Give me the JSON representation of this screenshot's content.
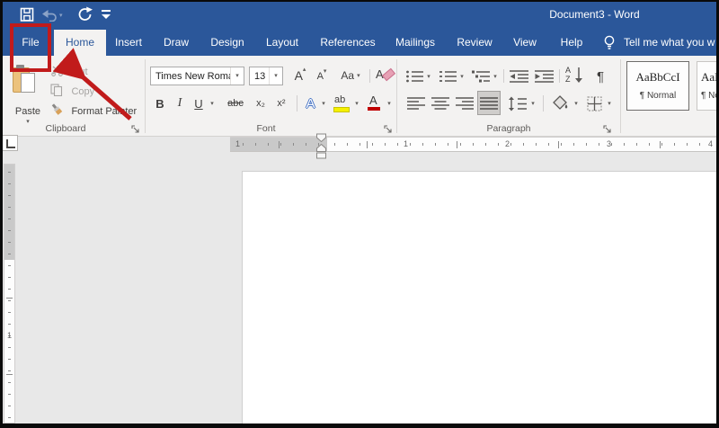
{
  "icons": {
    "caret": "▾",
    "caret_up": "▴"
  },
  "titlebar": {
    "title": "Document3 - Word"
  },
  "tabs": {
    "file": "File",
    "home": "Home",
    "insert": "Insert",
    "draw": "Draw",
    "design": "Design",
    "layout": "Layout",
    "references": "References",
    "mailings": "Mailings",
    "review": "Review",
    "view": "View",
    "help": "Help",
    "tell_me": "Tell me what you w"
  },
  "clipboard": {
    "label": "Clipboard",
    "paste": "Paste",
    "cut": "Cut",
    "copy": "Copy",
    "format_painter": "Format Painter"
  },
  "font": {
    "label": "Font",
    "name": "Times New Roma",
    "size": "13",
    "grow": "A",
    "shrink": "A",
    "change_case": "Aa",
    "clear": "A",
    "bold": "B",
    "italic": "I",
    "underline": "U",
    "strikethrough": "abc",
    "subscript": "x₂",
    "superscript": "x²",
    "effects": "A",
    "highlight": "ab",
    "color": "A"
  },
  "paragraph": {
    "label": "Paragraph",
    "sort_a": "A",
    "sort_z": "Z",
    "pilcrow": "¶"
  },
  "styles": {
    "normal_sample": "AaBbCcI",
    "normal_name": "¶ Normal",
    "nospacing_sample": "AaB",
    "nospacing_name": "¶ No"
  },
  "ruler": {
    "margin": "1",
    "n1": "1",
    "n2": "2",
    "n3": "3",
    "n4": "4",
    "v1": "1"
  },
  "colors": {
    "titlebar_blue": "#2B579A",
    "ribbon_gray": "#F3F2F1",
    "annotation_red": "#C11B1B",
    "highlight_yellow": "#F5F000",
    "font_color_red": "#C00000",
    "paste_clipboard_tan": "#ECC27C"
  }
}
